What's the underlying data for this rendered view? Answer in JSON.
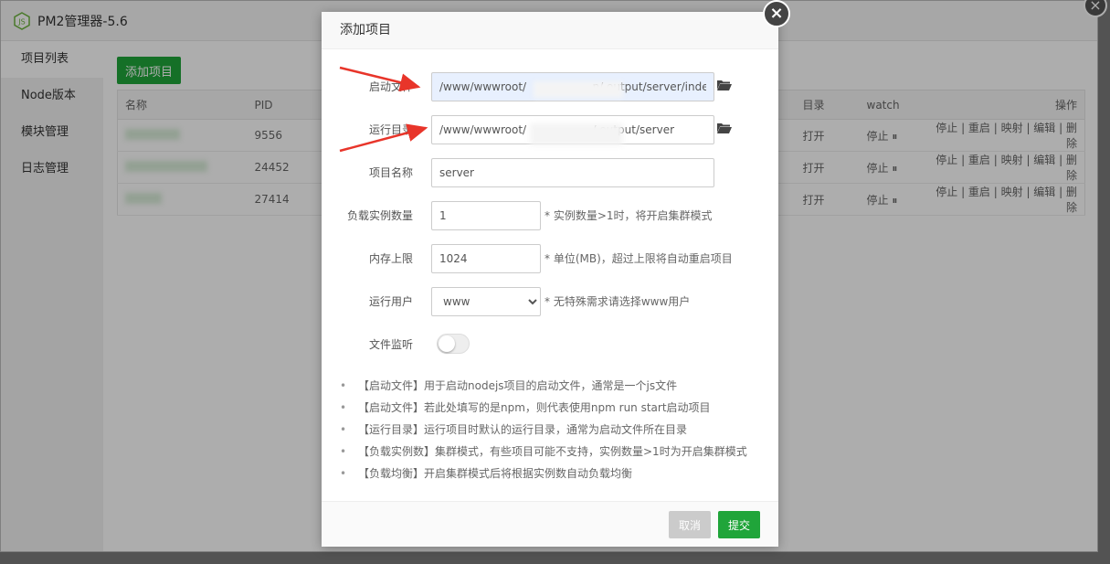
{
  "app": {
    "title": "PM2管理器-5.6",
    "sidebar": [
      "项目列表",
      "Node版本",
      "模块管理",
      "日志管理"
    ],
    "add_button": "添加项目",
    "table": {
      "headers": [
        "名称",
        "PID",
        "目录",
        "watch",
        "操作"
      ],
      "rows": [
        {
          "pid": "9556",
          "dir": "打开",
          "watch": "停止",
          "ops": [
            "停止",
            "重启",
            "映射",
            "编辑",
            "删除"
          ]
        },
        {
          "pid": "24452",
          "dir": "打开",
          "watch": "停止",
          "ops": [
            "停止",
            "重启",
            "映射",
            "编辑",
            "删除"
          ]
        },
        {
          "pid": "27414",
          "dir": "打开",
          "watch": "停止",
          "ops": [
            "停止",
            "重启",
            "映射",
            "编辑",
            "删除"
          ]
        }
      ]
    }
  },
  "modal": {
    "title": "添加项目",
    "fields": {
      "start_file": {
        "label": "启动文件",
        "value": "/www/wwwroot/                   n/.output/server/index.mjs"
      },
      "run_dir": {
        "label": "运行目录",
        "value": "/www/wwwroot/                   /.output/server"
      },
      "name": {
        "label": "项目名称",
        "value": "server"
      },
      "instances": {
        "label": "负载实例数量",
        "value": "1",
        "hint": "* 实例数量>1时，将开启集群模式"
      },
      "memory": {
        "label": "内存上限",
        "value": "1024",
        "hint": "* 单位(MB)，超过上限将自动重启项目"
      },
      "user": {
        "label": "运行用户",
        "value": "www",
        "hint": "* 无特殊需求请选择www用户"
      },
      "watch": {
        "label": "文件监听",
        "enabled": false
      }
    },
    "notes": [
      "【启动文件】用于启动nodejs项目的启动文件，通常是一个js文件",
      "【启动文件】若此处填写的是npm，则代表使用npm run start启动项目",
      "【运行目录】运行项目时默认的运行目录，通常为启动文件所在目录",
      "【负载实例数】集群模式，有些项目可能不支持，实例数量>1时为开启集群模式",
      "【负载均衡】开启集群模式后将根据实例数自动负载均衡"
    ],
    "cancel": "取消",
    "submit": "提交"
  },
  "colors": {
    "accent": "#20a53a",
    "danger": "#e00000",
    "annotation": "#e8352a"
  }
}
